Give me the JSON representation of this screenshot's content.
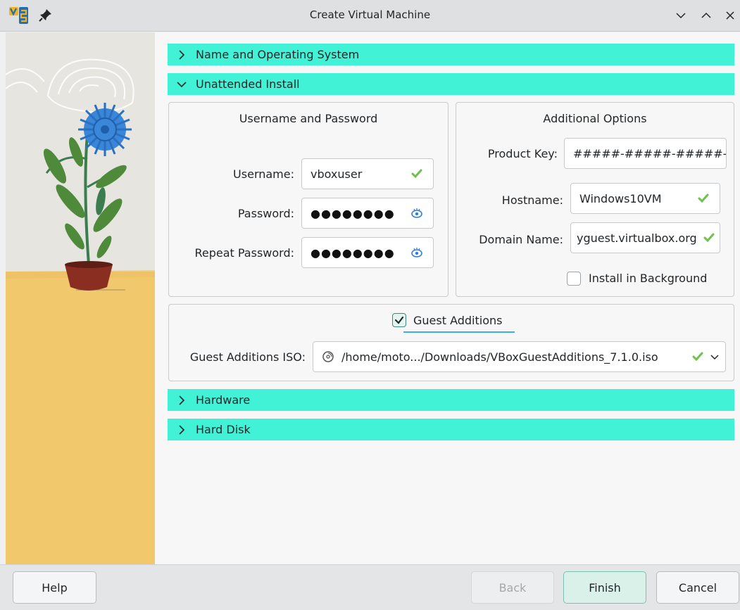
{
  "window": {
    "title": "Create Virtual Machine"
  },
  "sections": {
    "name_os": {
      "label": "Name and Operating System",
      "expanded": false
    },
    "unattended": {
      "label": "Unattended Install",
      "expanded": true
    },
    "hardware": {
      "label": "Hardware",
      "expanded": false
    },
    "hard_disk": {
      "label": "Hard Disk",
      "expanded": false
    }
  },
  "credentials": {
    "group_title": "Username and Password",
    "username_label": "Username:",
    "username_value": "vboxuser",
    "password_label": "Password:",
    "password_value": "●●●●●●●●",
    "repeat_label": "Repeat Password:",
    "repeat_value": "●●●●●●●●"
  },
  "options": {
    "group_title": "Additional Options",
    "product_key_label": "Product Key:",
    "product_key_value": "#####-#####-#####-#",
    "hostname_label": "Hostname:",
    "hostname_value": "Windows10VM",
    "domain_label": "Domain Name:",
    "domain_value": "yguest.virtualbox.org",
    "background_label": "Install in Background",
    "background_checked": false
  },
  "guest_additions": {
    "checkbox_label": "Guest Additions",
    "checked": true,
    "iso_label": "Guest Additions ISO:",
    "iso_value": "/home/moto.../Downloads/VBoxGuestAdditions_7.1.0.iso"
  },
  "buttons": {
    "help": "Help",
    "back": "Back",
    "finish": "Finish",
    "cancel": "Cancel"
  },
  "colors": {
    "section_header": "#41f2d6",
    "valid_check": "#6cc24a",
    "eye_icon": "#2f7fd6"
  },
  "icons": {
    "app": "virtualbox-logo-icon",
    "pin": "pin-icon",
    "minimize": "chevron-down-icon",
    "maximize": "chevron-up-icon",
    "close": "close-icon",
    "valid": "checkmark-icon",
    "show_password": "eye-icon",
    "disc": "disc-icon",
    "collapsed": "chevron-right-icon",
    "expanded": "chevron-down-icon"
  }
}
